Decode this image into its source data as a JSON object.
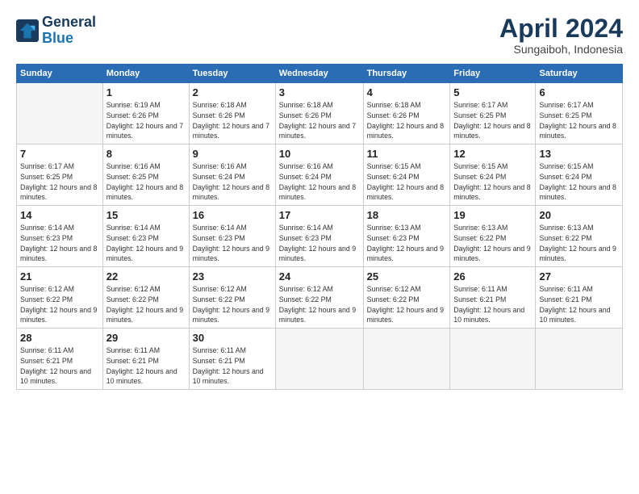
{
  "logo": {
    "line1": "General",
    "line2": "Blue"
  },
  "header": {
    "month": "April 2024",
    "location": "Sungaiboh, Indonesia"
  },
  "weekdays": [
    "Sunday",
    "Monday",
    "Tuesday",
    "Wednesday",
    "Thursday",
    "Friday",
    "Saturday"
  ],
  "rows": [
    [
      {
        "day": "",
        "sunrise": "",
        "sunset": "",
        "daylight": ""
      },
      {
        "day": "1",
        "sunrise": "Sunrise: 6:19 AM",
        "sunset": "Sunset: 6:26 PM",
        "daylight": "Daylight: 12 hours and 7 minutes."
      },
      {
        "day": "2",
        "sunrise": "Sunrise: 6:18 AM",
        "sunset": "Sunset: 6:26 PM",
        "daylight": "Daylight: 12 hours and 7 minutes."
      },
      {
        "day": "3",
        "sunrise": "Sunrise: 6:18 AM",
        "sunset": "Sunset: 6:26 PM",
        "daylight": "Daylight: 12 hours and 7 minutes."
      },
      {
        "day": "4",
        "sunrise": "Sunrise: 6:18 AM",
        "sunset": "Sunset: 6:26 PM",
        "daylight": "Daylight: 12 hours and 8 minutes."
      },
      {
        "day": "5",
        "sunrise": "Sunrise: 6:17 AM",
        "sunset": "Sunset: 6:25 PM",
        "daylight": "Daylight: 12 hours and 8 minutes."
      },
      {
        "day": "6",
        "sunrise": "Sunrise: 6:17 AM",
        "sunset": "Sunset: 6:25 PM",
        "daylight": "Daylight: 12 hours and 8 minutes."
      }
    ],
    [
      {
        "day": "7",
        "sunrise": "Sunrise: 6:17 AM",
        "sunset": "Sunset: 6:25 PM",
        "daylight": "Daylight: 12 hours and 8 minutes."
      },
      {
        "day": "8",
        "sunrise": "Sunrise: 6:16 AM",
        "sunset": "Sunset: 6:25 PM",
        "daylight": "Daylight: 12 hours and 8 minutes."
      },
      {
        "day": "9",
        "sunrise": "Sunrise: 6:16 AM",
        "sunset": "Sunset: 6:24 PM",
        "daylight": "Daylight: 12 hours and 8 minutes."
      },
      {
        "day": "10",
        "sunrise": "Sunrise: 6:16 AM",
        "sunset": "Sunset: 6:24 PM",
        "daylight": "Daylight: 12 hours and 8 minutes."
      },
      {
        "day": "11",
        "sunrise": "Sunrise: 6:15 AM",
        "sunset": "Sunset: 6:24 PM",
        "daylight": "Daylight: 12 hours and 8 minutes."
      },
      {
        "day": "12",
        "sunrise": "Sunrise: 6:15 AM",
        "sunset": "Sunset: 6:24 PM",
        "daylight": "Daylight: 12 hours and 8 minutes."
      },
      {
        "day": "13",
        "sunrise": "Sunrise: 6:15 AM",
        "sunset": "Sunset: 6:24 PM",
        "daylight": "Daylight: 12 hours and 8 minutes."
      }
    ],
    [
      {
        "day": "14",
        "sunrise": "Sunrise: 6:14 AM",
        "sunset": "Sunset: 6:23 PM",
        "daylight": "Daylight: 12 hours and 8 minutes."
      },
      {
        "day": "15",
        "sunrise": "Sunrise: 6:14 AM",
        "sunset": "Sunset: 6:23 PM",
        "daylight": "Daylight: 12 hours and 9 minutes."
      },
      {
        "day": "16",
        "sunrise": "Sunrise: 6:14 AM",
        "sunset": "Sunset: 6:23 PM",
        "daylight": "Daylight: 12 hours and 9 minutes."
      },
      {
        "day": "17",
        "sunrise": "Sunrise: 6:14 AM",
        "sunset": "Sunset: 6:23 PM",
        "daylight": "Daylight: 12 hours and 9 minutes."
      },
      {
        "day": "18",
        "sunrise": "Sunrise: 6:13 AM",
        "sunset": "Sunset: 6:23 PM",
        "daylight": "Daylight: 12 hours and 9 minutes."
      },
      {
        "day": "19",
        "sunrise": "Sunrise: 6:13 AM",
        "sunset": "Sunset: 6:22 PM",
        "daylight": "Daylight: 12 hours and 9 minutes."
      },
      {
        "day": "20",
        "sunrise": "Sunrise: 6:13 AM",
        "sunset": "Sunset: 6:22 PM",
        "daylight": "Daylight: 12 hours and 9 minutes."
      }
    ],
    [
      {
        "day": "21",
        "sunrise": "Sunrise: 6:12 AM",
        "sunset": "Sunset: 6:22 PM",
        "daylight": "Daylight: 12 hours and 9 minutes."
      },
      {
        "day": "22",
        "sunrise": "Sunrise: 6:12 AM",
        "sunset": "Sunset: 6:22 PM",
        "daylight": "Daylight: 12 hours and 9 minutes."
      },
      {
        "day": "23",
        "sunrise": "Sunrise: 6:12 AM",
        "sunset": "Sunset: 6:22 PM",
        "daylight": "Daylight: 12 hours and 9 minutes."
      },
      {
        "day": "24",
        "sunrise": "Sunrise: 6:12 AM",
        "sunset": "Sunset: 6:22 PM",
        "daylight": "Daylight: 12 hours and 9 minutes."
      },
      {
        "day": "25",
        "sunrise": "Sunrise: 6:12 AM",
        "sunset": "Sunset: 6:22 PM",
        "daylight": "Daylight: 12 hours and 9 minutes."
      },
      {
        "day": "26",
        "sunrise": "Sunrise: 6:11 AM",
        "sunset": "Sunset: 6:21 PM",
        "daylight": "Daylight: 12 hours and 10 minutes."
      },
      {
        "day": "27",
        "sunrise": "Sunrise: 6:11 AM",
        "sunset": "Sunset: 6:21 PM",
        "daylight": "Daylight: 12 hours and 10 minutes."
      }
    ],
    [
      {
        "day": "28",
        "sunrise": "Sunrise: 6:11 AM",
        "sunset": "Sunset: 6:21 PM",
        "daylight": "Daylight: 12 hours and 10 minutes."
      },
      {
        "day": "29",
        "sunrise": "Sunrise: 6:11 AM",
        "sunset": "Sunset: 6:21 PM",
        "daylight": "Daylight: 12 hours and 10 minutes."
      },
      {
        "day": "30",
        "sunrise": "Sunrise: 6:11 AM",
        "sunset": "Sunset: 6:21 PM",
        "daylight": "Daylight: 12 hours and 10 minutes."
      },
      {
        "day": "",
        "sunrise": "",
        "sunset": "",
        "daylight": ""
      },
      {
        "day": "",
        "sunrise": "",
        "sunset": "",
        "daylight": ""
      },
      {
        "day": "",
        "sunrise": "",
        "sunset": "",
        "daylight": ""
      },
      {
        "day": "",
        "sunrise": "",
        "sunset": "",
        "daylight": ""
      }
    ]
  ]
}
